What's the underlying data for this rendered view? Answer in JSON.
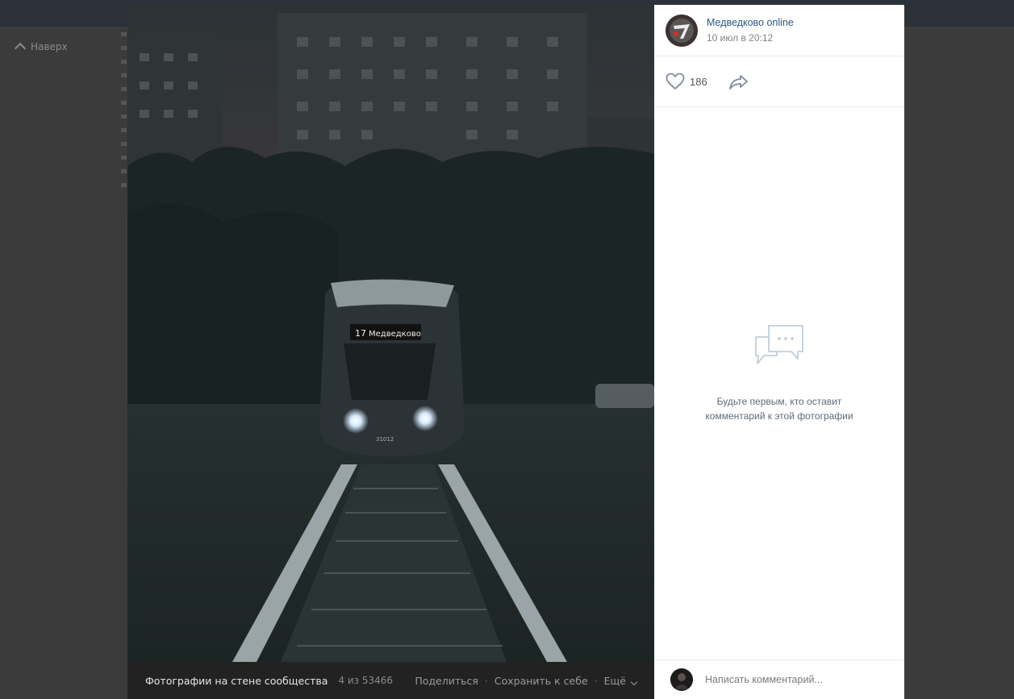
{
  "background": {
    "up_label": "Наверх"
  },
  "photo": {
    "tram_sign_number": "17",
    "tram_sign_text": "Медведково",
    "tram_fleet_number": "31012"
  },
  "photo_bar": {
    "album_label": "Фотографии на стене сообщества",
    "counter": "4 из 53466",
    "share_label": "Поделиться",
    "save_label": "Сохранить к себе",
    "more_label": "Ещё"
  },
  "side": {
    "group_name": "Медведково online",
    "post_date": "10 июл в 20:12",
    "likes": "186",
    "empty_line1": "Будьте первым, кто оставит",
    "empty_line2": "комментарий к этой фотографии",
    "comment_placeholder": "Написать комментарий..."
  },
  "colors": {
    "link": "#2a5885",
    "side_bg": "#ffffff",
    "overlay_bg": "#353535",
    "photo_bar_bg": "#222222"
  },
  "icons": {
    "like": "heart-icon",
    "share": "share-arrow-icon",
    "comments_empty": "speech-bubbles-icon",
    "up": "chevron-up-icon",
    "more": "chevron-down-icon"
  }
}
